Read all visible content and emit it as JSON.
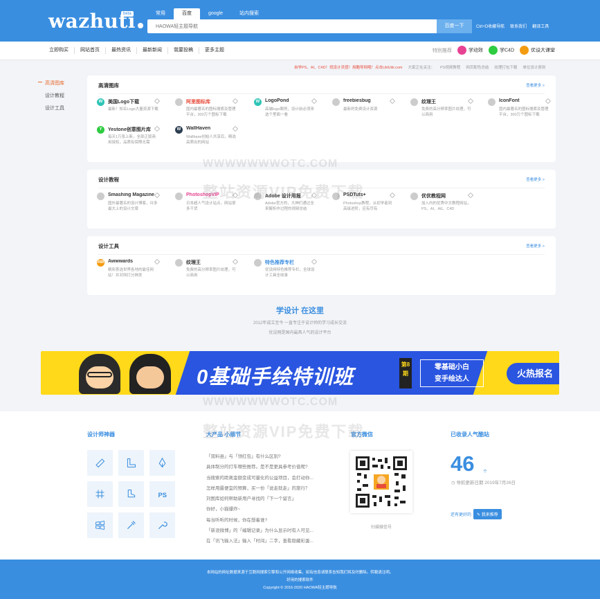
{
  "header": {
    "logo": "wazhuti",
    "beta": "beta",
    "search_tabs": [
      "常用",
      "百度",
      "google",
      "站内搜索"
    ],
    "search_placeholder": "HAOWA轻主题导航",
    "search_button": "百度一下",
    "links": [
      "Ctrl+D收藏导航",
      "联系我们",
      "翻译工具"
    ]
  },
  "nav": {
    "items": [
      "立即购买",
      "网站首页",
      "最热资讯",
      "最新新闻",
      "我要投稿",
      "更多主题"
    ],
    "recommend_label": "特别推荐",
    "recommend": [
      {
        "label": "学动效",
        "color": "#e84393"
      },
      {
        "label": "学C4D",
        "color": "#2ecc40"
      },
      {
        "label": "优设大课堂",
        "color": "#f39c12"
      }
    ]
  },
  "marquee": {
    "hot": "自学PS、AI、C4D！找设计灵感！用酷导网哦！点击UiiiUiiii.com",
    "items": [
      "大家正在关注：",
      "PS视频教程",
      "网页配色总结",
      "纹理打包下载",
      "单位设计原则"
    ]
  },
  "sidebar": {
    "items": [
      "高清图库",
      "设计教程",
      "设计工具"
    ]
  },
  "cards": [
    {
      "title": "高清图库",
      "more": "查看更多 >",
      "sites": [
        {
          "name": "美国Logo下载",
          "desc": "最新！知名Logo大量资源下载",
          "icon": "W",
          "color": "#2ec4b6",
          "name_color": "#333"
        },
        {
          "name": "阿里图标库",
          "desc": "国内最著名的图标搜索及管理平台，300万个图标下载",
          "icon": "",
          "color": "#ccc",
          "name_color": "#e74c3c"
        },
        {
          "name": "LogoPond",
          "desc": "高端logo案例，设计前必须来选个里面一看",
          "icon": "W",
          "color": "#2ec4b6",
          "name_color": "#333"
        },
        {
          "name": "freebiesbug",
          "desc": "最新的免费设计资源",
          "icon": "",
          "color": "#ccc",
          "name_color": "#333"
        },
        {
          "name": "纹理王",
          "desc": "免费的高分辨率图片纹理，可以商用",
          "icon": "",
          "color": "#ccc",
          "name_color": "#333"
        },
        {
          "name": "IconFont",
          "desc": "国内最著名的图标搜索及管理平台，300万个图标下载",
          "icon": "",
          "color": "#ccc",
          "name_color": "#333"
        },
        {
          "name": "Yestone创意图片库",
          "desc": "每天1万张上新，全部正版商用授权，品质有保障无需",
          "icon": "Y",
          "color": "#2ecc40",
          "name_color": "#333"
        },
        {
          "name": "WallHaven",
          "desc": "Wallbase创始人共享后，精选高质出的网站",
          "icon": "W",
          "color": "#2c3e50",
          "name_color": "#333"
        }
      ]
    },
    {
      "title": "设计教程",
      "more": "查看更多 >",
      "sites": [
        {
          "name": "Smashing Magazine",
          "desc": "国外最著名的设计博客，许多最大上的设计文章",
          "icon": "",
          "color": "#ccc",
          "name_color": "#333"
        },
        {
          "name": "PhotoshopVIP",
          "desc": "日本超人气设计站点，网站很多干货",
          "icon": "",
          "color": "#ccc",
          "name_color": "#e84393"
        },
        {
          "name": "Adobe 设计用报",
          "desc": "Adobe官方的，大神们通过全来解析作过程的视频总结",
          "icon": "",
          "color": "#ccc",
          "name_color": "#333"
        },
        {
          "name": "PSDTuts+",
          "desc": "Photoshop教程，从初学者到高级进阶，应有尽有",
          "icon": "",
          "color": "#ccc",
          "name_color": "#333"
        },
        {
          "name": "优优教程网",
          "desc": "加入内的优秀中文教程网站，PS、AI、AE、C4D",
          "icon": "",
          "color": "#ccc",
          "name_color": "#333"
        }
      ]
    },
    {
      "title": "设计工具",
      "more": "查看更多 >",
      "sites": [
        {
          "name": "Awwwards",
          "desc": "精彩荟选世界各地的最佳网站！并对网打分揭发",
          "icon": "AW",
          "color": "#f39c12",
          "name_color": "#333"
        },
        {
          "name": "纹理王",
          "desc": "免费的高分辨率图片纹理，可以商用",
          "icon": "",
          "color": "#ccc",
          "name_color": "#333"
        },
        {
          "name": "特色推荐专栏",
          "desc": "优设网特色推荐专栏，全球设计工具全收录",
          "icon": "",
          "color": "#ccc",
          "name_color": "#3a8ee0"
        }
      ]
    }
  ],
  "tagline": {
    "title": "学设计 在这里",
    "line1": "2012年成立至今 一直专注于设计师的学习成长交流",
    "line2": "优设网是国内最具人气的设计平台"
  },
  "banner": {
    "main": "0基础手绘特训班",
    "badge": "第8期",
    "sub1": "零基础小白",
    "sub2": "变手绘达人",
    "cta": "火热报名"
  },
  "watermark": {
    "url": "WWWWWWWOTC.COM",
    "text": "整站资源VIP免费下载"
  },
  "bottom": {
    "tools_title": "设计师神器",
    "news_title": "大产品 小细节",
    "news": [
      "「双料县」与「领红包」有什么区别?",
      "具体制分的打车哪些推荐。是不是更具参考价值呢?",
      "当搜索的距离金额变成可量化的公益项目，会打动你...",
      "怎样用最便宜的预算，买一份「说走就走」的旅行？",
      "刘图库如何帮助新用户寻找的「下一个留言」",
      "你好，小猫爆炸~",
      "每当听听的时候，你在想着谁?",
      "「新浪微博」的「编辑记录」为什么显示时有人可见...",
      "在「讯飞输入法」输入「时间」二字，查看隐藏彩蛋..."
    ],
    "wechat_title": "官方微信",
    "wechat_caption": "扫描微信号",
    "stats_title": "已收录人气酷站",
    "count": "46",
    "count_unit": "个",
    "count_date": "导航更新日期 2019年7月26日",
    "recommend_text": "还有更好的",
    "recommend_btn": "我来推荐"
  },
  "footer": {
    "line1": "本网站的网址数据来源于互联网搜索引擎和公开网络收集，如有信息请联系告知我们将及时删除。转载请注明。",
    "line2": "好用的搜索软件",
    "line3": "Copyright © 2016-2020 HAOWA轻主题导航"
  }
}
